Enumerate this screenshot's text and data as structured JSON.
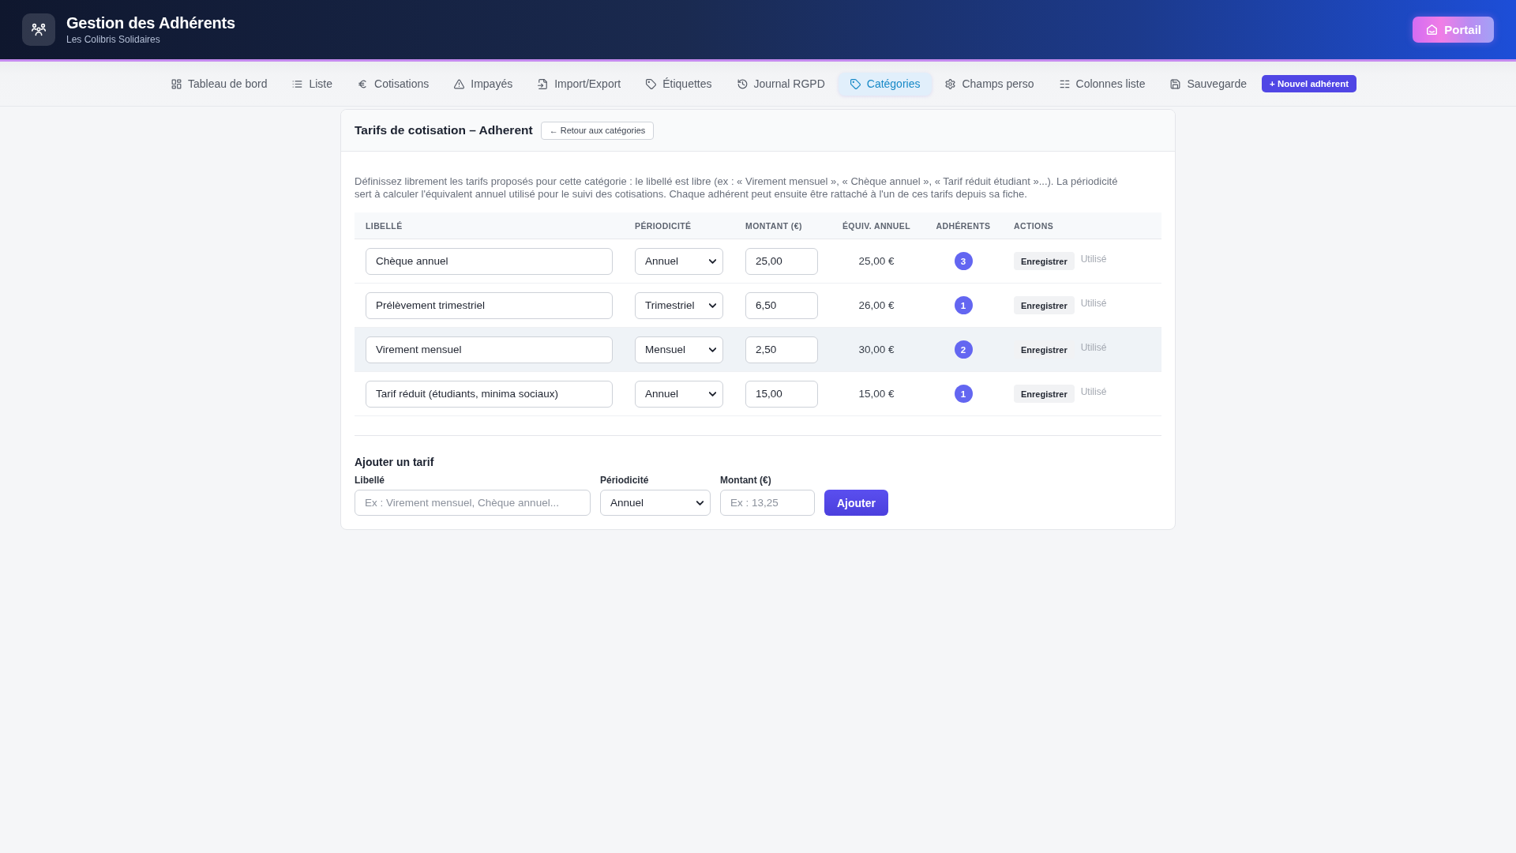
{
  "header": {
    "title": "Gestion des Adhérents",
    "subtitle": "Les Colibris Solidaires",
    "portal_button": "Portail"
  },
  "nav": {
    "tabs": [
      {
        "label": "Tableau de bord",
        "selected": false
      },
      {
        "label": "Liste",
        "selected": false
      },
      {
        "label": "Cotisations",
        "selected": false
      },
      {
        "label": "Impayés",
        "selected": false
      },
      {
        "label": "Import/Export",
        "selected": false
      },
      {
        "label": "Étiquettes",
        "selected": false
      },
      {
        "label": "Journal RGPD",
        "selected": false
      },
      {
        "label": "Catégories",
        "selected": true
      },
      {
        "label": "Champs perso",
        "selected": false
      },
      {
        "label": "Colonnes liste",
        "selected": false
      },
      {
        "label": "Sauvegarde",
        "selected": false
      }
    ],
    "new_member_button": "+ Nouvel adhérent"
  },
  "card": {
    "title": "Tarifs de cotisation – Adherent",
    "back_button": "← Retour aux catégories",
    "description": "Définissez librement les tarifs proposés pour cette catégorie : le libellé est libre (ex : « Virement mensuel », « Chèque annuel », « Tarif réduit étudiant »...). La périodicité sert à calculer l'équivalent annuel utilisé pour le suivi des cotisations. Chaque adhérent peut ensuite être rattaché à l'un de ces tarifs depuis sa fiche.",
    "table": {
      "columns": [
        "LIBELLÉ",
        "PÉRIODICITÉ",
        "MONTANT (€)",
        "ÉQUIV. ANNUEL",
        "ADHÉRENTS",
        "ACTIONS"
      ],
      "rows": [
        {
          "label": "Chèque annuel",
          "periodicity": "Annuel",
          "amount": "25,00",
          "annual_equivalent": "25,00 €",
          "members": "3",
          "save_button": "Enregistrer",
          "status": "Utilisé",
          "highlighted": false
        },
        {
          "label": "Prélèvement trimestriel",
          "periodicity": "Trimestriel",
          "amount": "6,50",
          "annual_equivalent": "26,00 €",
          "members": "1",
          "save_button": "Enregistrer",
          "status": "Utilisé",
          "highlighted": false
        },
        {
          "label": "Virement mensuel",
          "periodicity": "Mensuel",
          "amount": "2,50",
          "annual_equivalent": "30,00 €",
          "members": "2",
          "save_button": "Enregistrer",
          "status": "Utilisé",
          "highlighted": true
        },
        {
          "label": "Tarif réduit (étudiants, minima sociaux)",
          "periodicity": "Annuel",
          "amount": "15,00",
          "annual_equivalent": "15,00 €",
          "members": "1",
          "save_button": "Enregistrer",
          "status": "Utilisé",
          "highlighted": false
        }
      ]
    },
    "add_form": {
      "title": "Ajouter un tarif",
      "label_field": {
        "label": "Libellé",
        "placeholder": "Ex : Virement mensuel, Chèque annuel..."
      },
      "periodicity_field": {
        "label": "Périodicité",
        "value": "Annuel"
      },
      "amount_field": {
        "label": "Montant (€)",
        "placeholder": "Ex : 13,25"
      },
      "submit_button": "Ajouter"
    }
  }
}
